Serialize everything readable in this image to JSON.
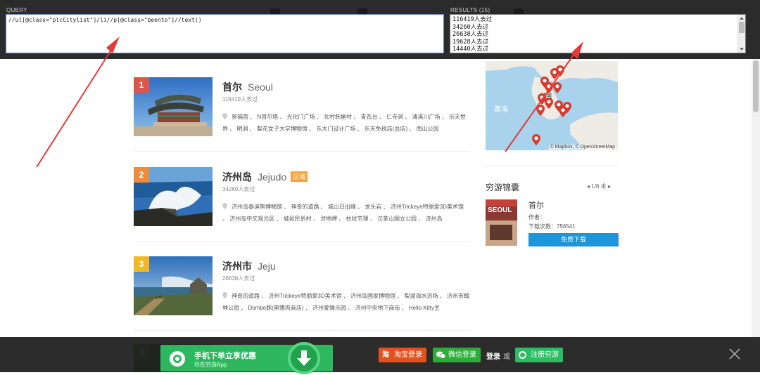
{
  "overlay": {
    "query_label": "QUERY",
    "query_value": "//ul[@class=\"plcCitylist\"]/li//p[@class=\"beento\"]//text()",
    "results_label": "RESULTS (15)",
    "results": [
      "116419人去过",
      "34260人去过",
      "26638人去过",
      "19628人去过",
      "14440人去过"
    ]
  },
  "cities": [
    {
      "rank": "1",
      "rank_color": "#e0554b",
      "name_cn": "首尔",
      "name_en": "Seoul",
      "tag": "",
      "visits": "116419人去过",
      "pois": "景福宫 、 N首尔塔 、 光化门广场 、 北村韩屋村 、 青瓦台 、 仁寺洞 、 清溪川广场 、 乐天世界 、 明洞 、 梨花女子大学博物馆 、 东大门设计广场 、 乐天免税店(总店) 、 南山公园"
    },
    {
      "rank": "2",
      "rank_color": "#f08a3c",
      "name_cn": "济州岛",
      "name_en": "Jejudo",
      "tag": "区域",
      "visits": "34260人去过",
      "pois": "济州岛泰迪熊博物馆 、 神奇的道路 、 城山日出峰 、 龙头岩 、 济州Trickeye特丽爱3D美术馆 、 济州岛中文观光区 、 城邑民俗村 、 涉地岬 、 柱状节理 、 汉拿山国立公园 、 济州岛"
    },
    {
      "rank": "3",
      "rank_color": "#f2b824",
      "name_cn": "济州市",
      "name_en": "Jeju",
      "tag": "",
      "visits": "26638人去过",
      "pois": "神奇的道路 、 济州Trickeye特丽爱3D美术馆 、 济州岛国家博物馆 、 梨湖海水浴场 、 济州市翰林公园 、 Dombe豚(黑猪肉商店) 、 济州爱情乐园 、 济州中央地下商街 、 Hello Kitty主"
    },
    {
      "rank": "4",
      "rank_color": "#6ab04c"
    }
  ],
  "map": {
    "label": "韩国",
    "sea": "黄海",
    "credit": "© Mapbox, © OpenStreetMap"
  },
  "guide": {
    "section_title": "穷游锦囊",
    "pager": "1/8 本",
    "title": "首尔",
    "author_label": "作者：",
    "downloads": "下载次数：756541",
    "download_button": "免费下载",
    "cover_text": "SEOUL"
  },
  "bottom": {
    "promo_title": "手机下单立享优惠",
    "promo_sub": "尽在穷游App",
    "taobao": "淘宝登录",
    "wechat": "微信登录",
    "login": "登录",
    "or": "或",
    "register": "注册穷游"
  },
  "colors": {
    "taobao": "#e5511d",
    "wechat": "#2aae37",
    "register": "#2bbd63",
    "download": "#1e95d8",
    "arrow": "#e53935"
  }
}
